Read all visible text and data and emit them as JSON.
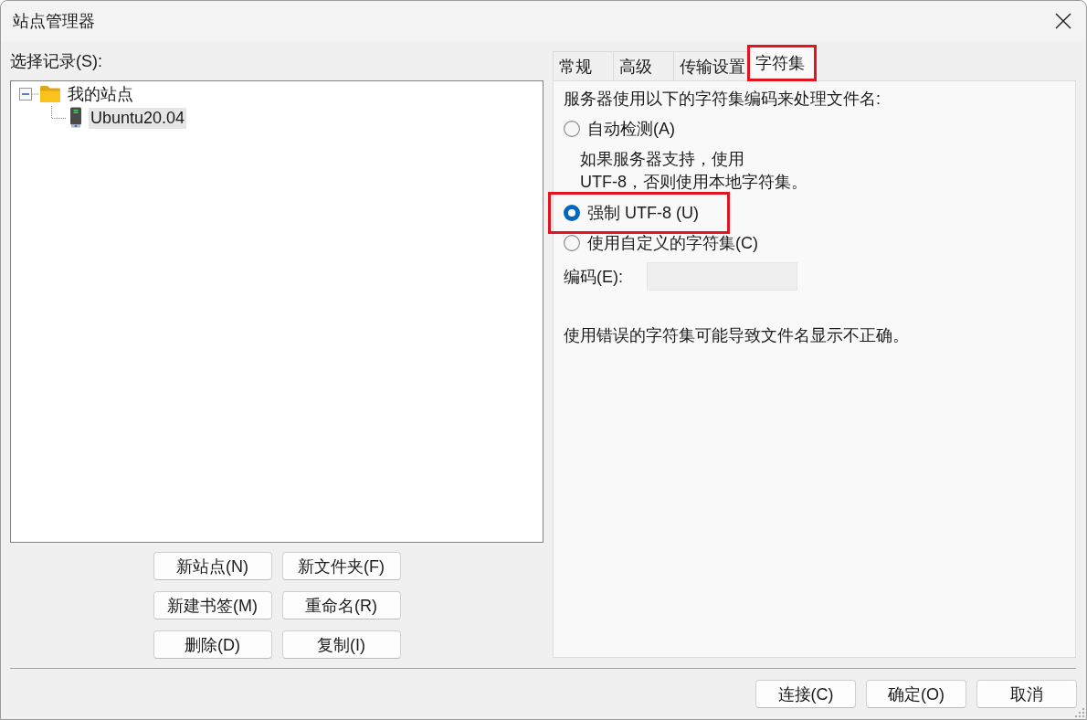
{
  "window": {
    "title": "站点管理器"
  },
  "site_tree": {
    "label": "选择记录(S):",
    "items": [
      {
        "label": "我的站点",
        "kind": "folder",
        "expanded": true,
        "selected": false,
        "children": [
          {
            "label": "Ubuntu20.04",
            "kind": "server",
            "selected": true
          }
        ]
      }
    ]
  },
  "site_buttons": [
    "新站点(N)",
    "新文件夹(F)",
    "新建书签(M)",
    "重命名(R)",
    "删除(D)",
    "复制(I)"
  ],
  "tabs": [
    {
      "label": "常规",
      "selected": false,
      "highlighted": false
    },
    {
      "label": "高级",
      "selected": false,
      "highlighted": false
    },
    {
      "label": "传输设置",
      "selected": false,
      "highlighted": false
    },
    {
      "label": "字符集",
      "selected": true,
      "highlighted": true
    }
  ],
  "charset_panel": {
    "heading": "服务器使用以下的字符集编码来处理文件名:",
    "options": [
      {
        "label": "自动检测(A)",
        "selected": false,
        "highlighted": false,
        "description_lines": [
          "如果服务器支持，使用",
          "UTF-8，否则使用本地字符集。"
        ]
      },
      {
        "label": "强制 UTF-8 (U)",
        "selected": true,
        "highlighted": true
      },
      {
        "label": "使用自定义的字符集(C)",
        "selected": false,
        "highlighted": false
      }
    ],
    "encoding_field": {
      "label": "编码(E):",
      "disabled": true
    },
    "note": "使用错误的字符集可能导致文件名显示不正确。"
  },
  "dialog_buttons": [
    "连接(C)",
    "确定(O)",
    "取消"
  ]
}
